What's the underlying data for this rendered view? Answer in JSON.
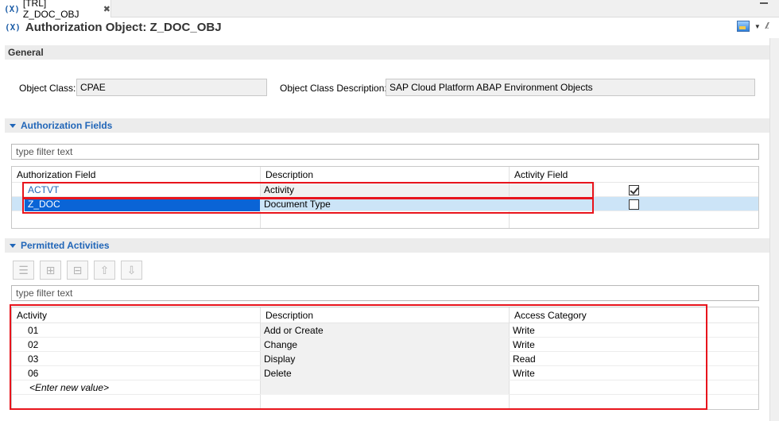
{
  "tab": {
    "title": "[TRL] Z_DOC_OBJ",
    "close": "✖"
  },
  "editor": {
    "icon_text": "(X)",
    "title": "Authorization Object: Z_DOC_OBJ"
  },
  "general": {
    "header": "General",
    "object_class_label": "Object Class:",
    "object_class_value": "CPAE",
    "object_class_desc_label": "Object Class Description:",
    "object_class_desc_value": "SAP Cloud Platform ABAP Environment Objects"
  },
  "auth_fields": {
    "header": "Authorization Fields",
    "filter_placeholder": "type filter text",
    "columns": [
      "Authorization Field",
      "Description",
      "Activity Field"
    ],
    "rows": [
      {
        "field": "ACTVT",
        "description": "Activity",
        "activity_field": true
      },
      {
        "field": "Z_DOC",
        "description": "Document Type",
        "activity_field": false
      }
    ]
  },
  "permitted": {
    "header": "Permitted Activities",
    "filter_placeholder": "type filter text",
    "actions": [
      "add-icon",
      "insert-icon",
      "remove-icon",
      "move-up-icon",
      "move-down-icon"
    ],
    "columns": [
      "Activity",
      "Description",
      "Access Category"
    ],
    "rows": [
      {
        "activity": "01",
        "description": "Add or Create",
        "category": "Write"
      },
      {
        "activity": "02",
        "description": "Change",
        "category": "Write"
      },
      {
        "activity": "03",
        "description": "Display",
        "category": "Read"
      },
      {
        "activity": "06",
        "description": "Delete",
        "category": "Write"
      }
    ],
    "new_value": "<Enter new value>"
  },
  "colors": {
    "accent": "#2166b8",
    "selection": "#0a64d6",
    "highlight_box": "#e8141c"
  }
}
